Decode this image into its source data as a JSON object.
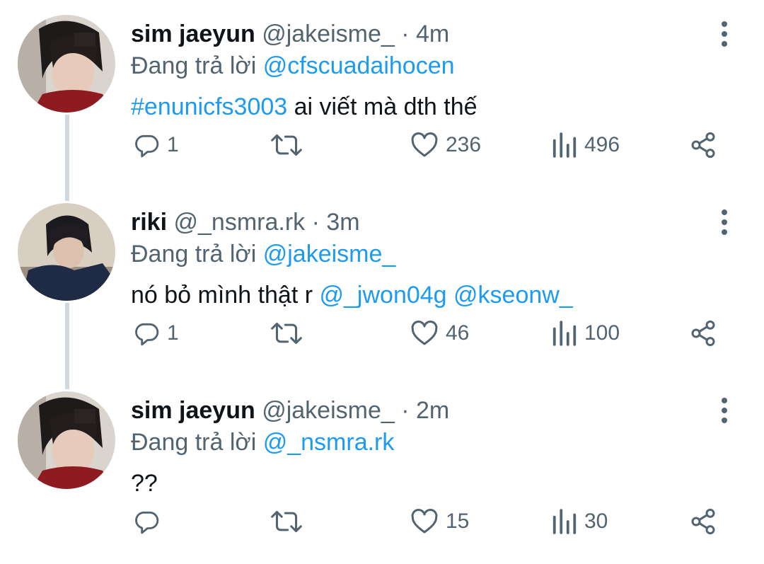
{
  "tweets": [
    {
      "name": "sim jaeyun",
      "handle": "@jakeisme_",
      "time": "· 4m",
      "replying_prefix": "Đang trả lời",
      "replying_to": "@cfscuadaihocen",
      "text_link": "#enunicfs3003",
      "text": " ai viết mà dth thế",
      "replies": "1",
      "likes": "236",
      "views": "496"
    },
    {
      "name": "riki",
      "handle": "@_nsmra.rk",
      "time": "· 3m",
      "replying_prefix": "Đang trả lời",
      "replying_to": "@jakeisme_",
      "text": "nó bỏ mình thật r ",
      "text_link": "@_jwon04g @kseonw_",
      "replies": "1",
      "likes": "46",
      "views": "100"
    },
    {
      "name": "sim jaeyun",
      "handle": "@jakeisme_",
      "time": "· 2m",
      "replying_prefix": "Đang trả lời",
      "replying_to": "@_nsmra.rk",
      "text": "??",
      "replies": "",
      "likes": "15",
      "views": "30"
    }
  ],
  "icons": {
    "reply": "reply-icon",
    "retweet": "retweet-icon",
    "like": "heart-icon",
    "views": "views-icon",
    "share": "share-icon",
    "more": "more-vertical-icon"
  },
  "colors": {
    "link": "#1d9bf0",
    "secondary": "#536471",
    "line": "#cfd9de"
  }
}
